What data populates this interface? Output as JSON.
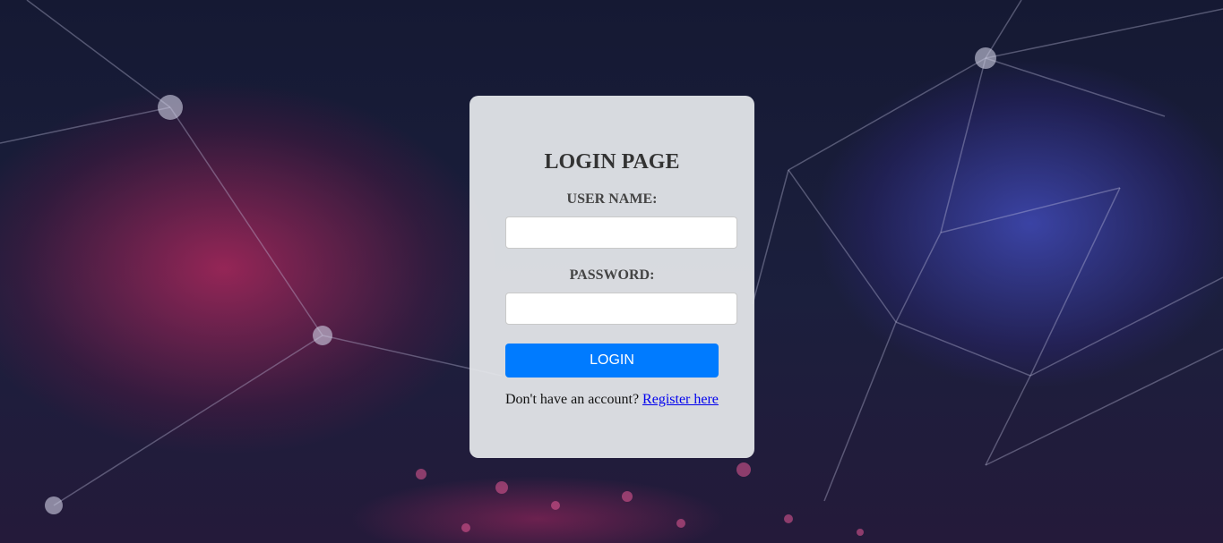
{
  "login": {
    "title": "LOGIN PAGE",
    "username_label": "USER NAME:",
    "username_value": "",
    "password_label": "PASSWORD:",
    "password_value": "",
    "submit_label": "LOGIN",
    "register_prompt": "Don't have an account?",
    "register_link": "Register here"
  },
  "colors": {
    "button": "#007bff",
    "card": "#e6e8ec",
    "link": "#0000ee",
    "background": "#151a33"
  }
}
